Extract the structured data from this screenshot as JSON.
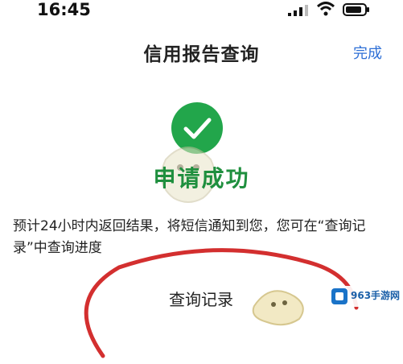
{
  "status_bar": {
    "time": "16:45",
    "icons": [
      "signal-icon",
      "wifi-icon",
      "battery-icon"
    ]
  },
  "nav": {
    "title": "信用报告查询",
    "done_label": "完成"
  },
  "result": {
    "icon": "success-checkmark-icon",
    "status_text": "申请成功",
    "info_text": "预计24小时内返回结果，将短信通知到您，您可在“查询记录”中查询进度"
  },
  "actions": {
    "query_record_label": "查询记录"
  },
  "watermark": {
    "site_name": "963手游网"
  },
  "colors": {
    "success": "#22a64b",
    "accent": "#2e6fd6",
    "annotation": "#d32f2f"
  }
}
